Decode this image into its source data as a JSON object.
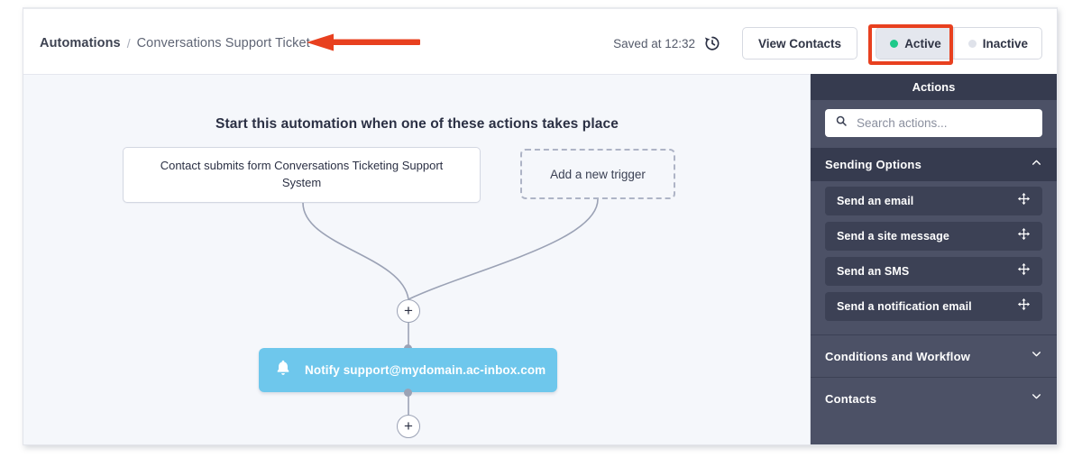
{
  "header": {
    "breadcrumb_root": "Automations",
    "breadcrumb_separator": "/",
    "breadcrumb_leaf": "Conversations Support Ticket",
    "saved_text": "Saved at 12:32",
    "history_icon": "history-clock-icon",
    "view_contacts_label": "View Contacts",
    "status_active_label": "Active",
    "status_inactive_label": "Inactive",
    "active_dot_color": "#1ec98a",
    "inactive_dot_color": "#dfe2ea",
    "annotation_color": "#e8401f"
  },
  "canvas": {
    "title": "Start this automation when one of these actions takes place",
    "trigger_label": "Contact submits form Conversations Ticketing Support System",
    "add_trigger_label": "Add a new trigger",
    "plus_label": "+",
    "action_node": {
      "label": "Notify support@mydomain.ac-inbox.com",
      "icon": "bell-icon",
      "color": "#6ec7ec"
    }
  },
  "sidebar": {
    "title": "Actions",
    "search_placeholder": "Search actions...",
    "search_value": "",
    "search_icon": "search-icon",
    "sections": [
      {
        "label": "Sending Options",
        "expanded": true,
        "chevron": "chevron-up-icon",
        "items": [
          {
            "label": "Send an email",
            "handle_icon": "move-icon"
          },
          {
            "label": "Send a site message",
            "handle_icon": "move-icon"
          },
          {
            "label": "Send an SMS",
            "handle_icon": "move-icon"
          },
          {
            "label": "Send a notification email",
            "handle_icon": "move-icon"
          }
        ]
      },
      {
        "label": "Conditions and Workflow",
        "expanded": false,
        "chevron": "chevron-down-icon",
        "items": []
      },
      {
        "label": "Contacts",
        "expanded": false,
        "chevron": "chevron-down-icon",
        "items": []
      }
    ]
  }
}
